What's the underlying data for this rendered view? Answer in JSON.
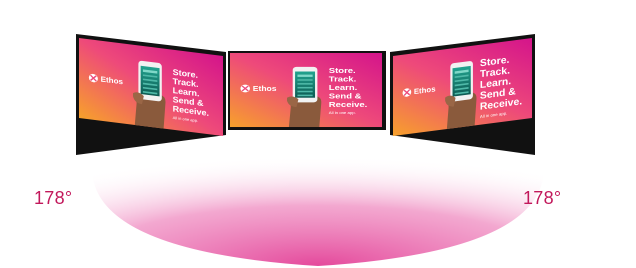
{
  "colors": {
    "angle_text": "#c2185b",
    "screen_gradient_start": "#f7a12b",
    "screen_gradient_mid": "#ee4a7a",
    "screen_gradient_end": "#d4148b",
    "arc_fill": "#e33f96",
    "bezel": "#111111"
  },
  "viewing_angle": {
    "left_label": "178°",
    "right_label": "178°"
  },
  "screens": [
    {
      "name": "left",
      "brand": "Ethos",
      "headline": [
        "Store.",
        "Track.",
        "Learn.",
        "Send &",
        "Receive."
      ],
      "tagline": "All in one app."
    },
    {
      "name": "center",
      "brand": "Ethos",
      "headline": [
        "Store.",
        "Track.",
        "Learn.",
        "Send &",
        "Receive."
      ],
      "tagline": "All in one app."
    },
    {
      "name": "right",
      "brand": "Ethos",
      "headline": [
        "Store.",
        "Track.",
        "Learn.",
        "Send &",
        "Receive."
      ],
      "tagline": "All in one app."
    }
  ]
}
